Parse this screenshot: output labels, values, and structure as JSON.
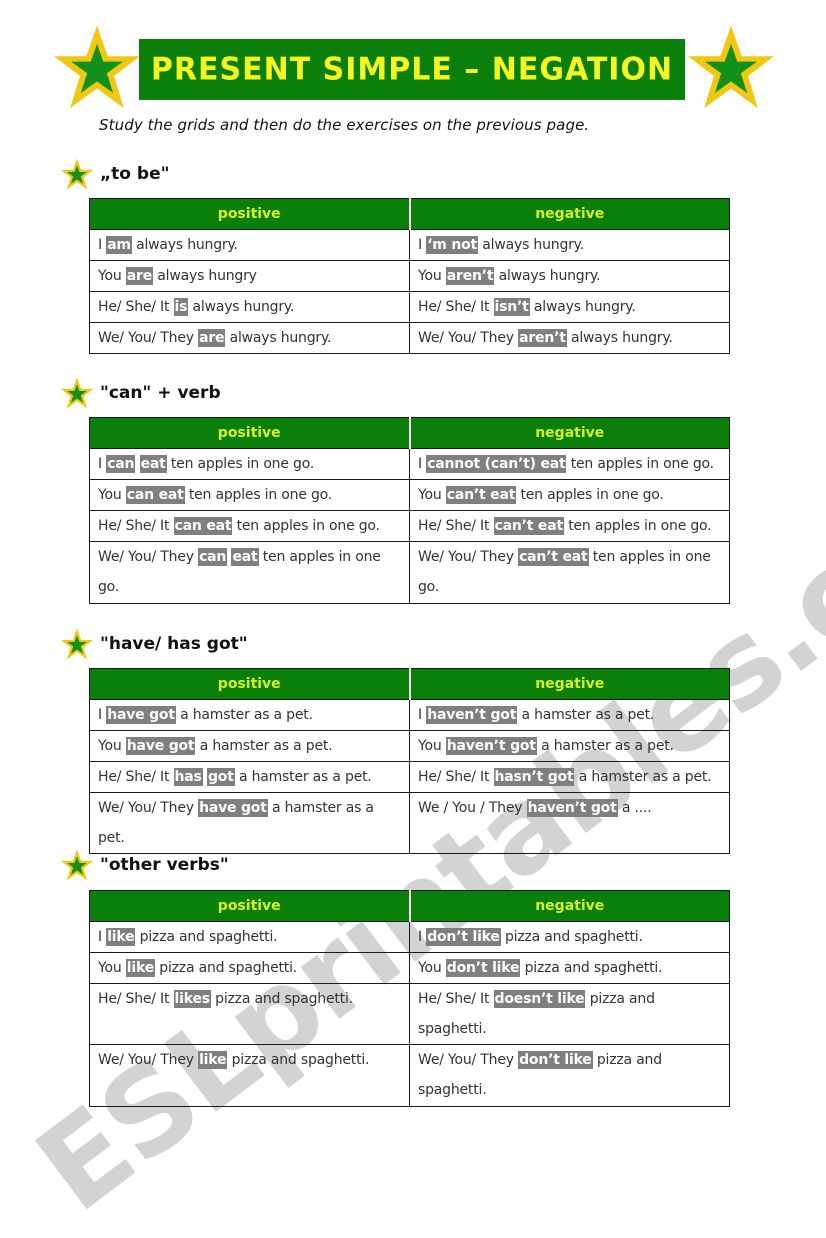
{
  "title": "PRESENT SIMPLE – NEGATION",
  "instruction": "Study the grids and then do the exercises on the previous page.",
  "watermark": "ESLprintables.com",
  "colors": {
    "banner_green": "#0a7f0a",
    "title_yellow": "#f5f520",
    "header_text": "#d7f020",
    "highlight_gray": "#7f7f7f",
    "star_outer": "#f0c814",
    "star_inner": "#12901a"
  },
  "sections": [
    {
      "heading": "„to be\"",
      "columns": [
        "positive",
        "negative"
      ],
      "rows": [
        {
          "positive": {
            "pre": "I ",
            "hl": [
              "am"
            ],
            "post": " always hungry."
          },
          "negative": {
            "pre": "I ",
            "hl": [
              "‘m not"
            ],
            "post": " always hungry."
          }
        },
        {
          "positive": {
            "pre": "You ",
            "hl": [
              "are"
            ],
            "post": " always hungry"
          },
          "negative": {
            "pre": "You ",
            "hl": [
              "aren’t"
            ],
            "post": " always hungry."
          }
        },
        {
          "positive": {
            "pre": "He/ She/ It ",
            "hl": [
              "is"
            ],
            "post": " always hungry."
          },
          "negative": {
            "pre": "He/ She/ It ",
            "hl": [
              "isn’t"
            ],
            "post": " always hungry."
          }
        },
        {
          "positive": {
            "pre": "We/ You/ They ",
            "hl": [
              "are"
            ],
            "post": " always hungry."
          },
          "negative": {
            "pre": "We/ You/ They ",
            "hl": [
              "aren’t"
            ],
            "post": " always hungry."
          }
        }
      ]
    },
    {
      "heading": "\"can\" + verb",
      "columns": [
        "positive",
        "negative"
      ],
      "rows": [
        {
          "positive": {
            "pre": "I ",
            "hl": [
              "can",
              "eat"
            ],
            "post": " ten apples in one go."
          },
          "negative": {
            "pre": "I ",
            "hl": [
              "cannot (can’t) eat"
            ],
            "post": " ten apples in one go."
          }
        },
        {
          "positive": {
            "pre": "You ",
            "hl": [
              "can eat"
            ],
            "post": " ten apples in one go."
          },
          "negative": {
            "pre": "You ",
            "hl": [
              "can’t eat"
            ],
            "post": " ten apples in one go."
          }
        },
        {
          "positive": {
            "pre": "He/ She/ It ",
            "hl": [
              "can eat"
            ],
            "post": " ten apples in one go."
          },
          "negative": {
            "pre": "He/ She/ It ",
            "hl": [
              "can’t eat"
            ],
            "post": " ten apples in one go."
          }
        },
        {
          "positive": {
            "pre": "We/ You/ They ",
            "hl": [
              "can",
              "eat"
            ],
            "post": " ten apples in one go."
          },
          "negative": {
            "pre": "We/ You/ They ",
            "hl": [
              "can’t eat"
            ],
            "post": " ten apples in one go."
          },
          "tall": true
        }
      ]
    },
    {
      "heading": "\"have/ has got\"",
      "columns": [
        "positive",
        "negative"
      ],
      "rows": [
        {
          "positive": {
            "pre": "I ",
            "hl": [
              "have got"
            ],
            "post": " a hamster as a pet."
          },
          "negative": {
            "pre": "I ",
            "hl": [
              "haven’t got"
            ],
            "post": " a hamster as a pet."
          }
        },
        {
          "positive": {
            "pre": "You ",
            "hl": [
              "have got"
            ],
            "post": " a hamster as a pet."
          },
          "negative": {
            "pre": "You ",
            "hl": [
              "haven’t got"
            ],
            "post": " a hamster as a pet."
          }
        },
        {
          "positive": {
            "pre": "He/ She/ It ",
            "hl": [
              "has",
              "got"
            ],
            "post": " a hamster as a pet."
          },
          "negative": {
            "pre": "He/ She/ It ",
            "hl": [
              "hasn’t got"
            ],
            "post": " a hamster as a pet."
          }
        },
        {
          "positive": {
            "pre": "We/ You/ They ",
            "hl": [
              "have got"
            ],
            "post": " a hamster as a pet."
          },
          "negative": {
            "pre": "We / You / They ",
            "hl": [
              "haven’t got"
            ],
            "post": " a ...."
          }
        }
      ]
    },
    {
      "heading": "\"other verbs\"",
      "columns": [
        "positive",
        "negative"
      ],
      "rows": [
        {
          "positive": {
            "pre": "I ",
            "hl": [
              "like"
            ],
            "post": " pizza and spaghetti."
          },
          "negative": {
            "pre": "I ",
            "hl": [
              "don’t like"
            ],
            "post": " pizza and spaghetti."
          }
        },
        {
          "positive": {
            "pre": "You ",
            "hl": [
              "like"
            ],
            "post": " pizza and spaghetti."
          },
          "negative": {
            "pre": "You ",
            "hl": [
              "don’t like"
            ],
            "post": " pizza and spaghetti."
          }
        },
        {
          "positive": {
            "pre": "He/ She/ It ",
            "hl": [
              "likes"
            ],
            "post": " pizza and spaghetti."
          },
          "negative": {
            "pre": "He/ She/ It ",
            "hl": [
              "doesn’t like"
            ],
            "post": " pizza and spaghetti."
          }
        },
        {
          "positive": {
            "pre": "We/ You/ They ",
            "hl": [
              "like"
            ],
            "post": " pizza and spaghetti."
          },
          "negative": {
            "pre": "We/ You/ They ",
            "hl": [
              "don’t like"
            ],
            "post": " pizza and spaghetti."
          },
          "tall": true
        }
      ]
    }
  ]
}
